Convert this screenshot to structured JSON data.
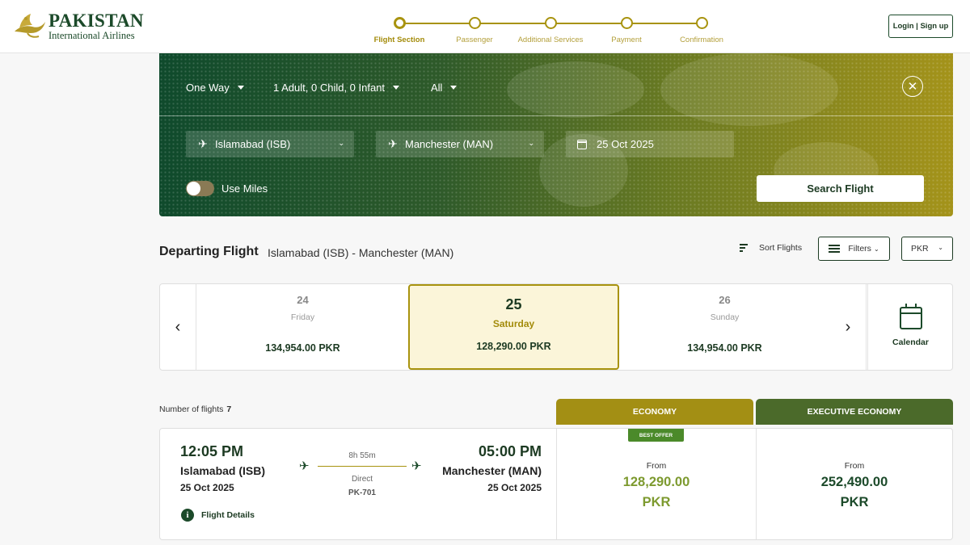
{
  "brand": {
    "name": "PAKISTAN",
    "subtitle": "International Airlines",
    "logo_icon": "pia-markhor-logo"
  },
  "steps": [
    {
      "label": "Flight Section",
      "active": true
    },
    {
      "label": "Passenger",
      "active": false
    },
    {
      "label": "Additional Services",
      "active": false
    },
    {
      "label": "Payment",
      "active": false
    },
    {
      "label": "Confirmation",
      "active": false
    }
  ],
  "header": {
    "login_label": "Login | Sign up"
  },
  "search": {
    "trip_type": "One Way",
    "passengers": "1 Adult, 0 Child, 0 Infant",
    "cabin": "All",
    "from": "Islamabad (ISB)",
    "to": "Manchester (MAN)",
    "date": "25 Oct 2025",
    "use_miles_label": "Use Miles",
    "use_miles_enabled": false,
    "search_button": "Search Flight",
    "close_icon": "close-icon"
  },
  "results_header": {
    "title": "Departing Flight",
    "route": "Islamabad (ISB) - Manchester (MAN)",
    "sort_label": "Sort Flights",
    "filters_label": "Filters",
    "currency": "PKR"
  },
  "date_carousel": {
    "days": [
      {
        "day": "24",
        "weekday": "Friday",
        "price": "134,954.00 PKR",
        "selected": false
      },
      {
        "day": "25",
        "weekday": "Saturday",
        "price": "128,290.00 PKR",
        "selected": true
      },
      {
        "day": "26",
        "weekday": "Sunday",
        "price": "134,954.00 PKR",
        "selected": false
      }
    ],
    "calendar_label": "Calendar"
  },
  "results": {
    "count_label": "Number of flights",
    "count": "7",
    "cabins": [
      "ECONOMY",
      "EXECUTIVE ECONOMY"
    ],
    "flights": [
      {
        "dep_time": "12:05 PM",
        "dep_city": "Islamabad (ISB)",
        "dep_date": "25 Oct 2025",
        "arr_time": "05:00 PM",
        "arr_city": "Manchester (MAN)",
        "arr_date": "25 Oct 2025",
        "duration": "8h 55m",
        "stops": "Direct",
        "flight_no": "PK-701",
        "details_label": "Flight Details",
        "economy": {
          "badge": "BEST OFFER",
          "from": "From",
          "amount": "128,290.00",
          "currency": "PKR"
        },
        "executive": {
          "from": "From",
          "amount": "252,490.00",
          "currency": "PKR"
        }
      }
    ]
  },
  "colors": {
    "brand_green": "#1c4a2a",
    "brand_gold": "#a8930f",
    "economy_tab": "#a38f14",
    "executive_tab": "#4b6a2a"
  }
}
